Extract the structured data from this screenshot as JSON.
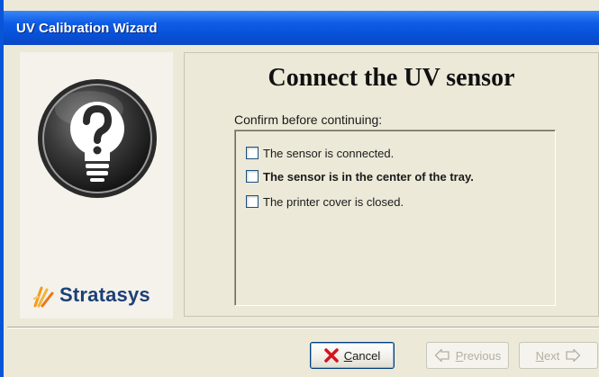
{
  "window": {
    "title": "UV Calibration Wizard"
  },
  "logo_panel": {
    "help_icon": "question-lightbulb-icon",
    "brand_name": "Stratasys",
    "brand_icon": "stratasys-flame-icon"
  },
  "content": {
    "title": "Connect the UV sensor",
    "confirm_label": "Confirm before continuing:",
    "checklist": [
      {
        "label": "The sensor is connected.",
        "checked": false,
        "bold": false
      },
      {
        "label": "The sensor is in the center of the tray.",
        "checked": false,
        "bold": true
      },
      {
        "label": "The printer cover is closed.",
        "checked": false,
        "bold": false
      }
    ]
  },
  "buttons": {
    "cancel": {
      "accel": "C",
      "rest": "ancel",
      "icon": "red-x-icon",
      "enabled": true
    },
    "previous": {
      "accel": "P",
      "rest": "revious",
      "icon": "left-arrow-icon",
      "enabled": false
    },
    "next": {
      "accel": "N",
      "rest": "ext",
      "icon": "right-arrow-icon",
      "enabled": false
    }
  },
  "colors": {
    "titlebar": "#0a54d8",
    "background": "#ece9d8",
    "brand": "#1c3f78",
    "cancel_icon": "#d0161c"
  }
}
